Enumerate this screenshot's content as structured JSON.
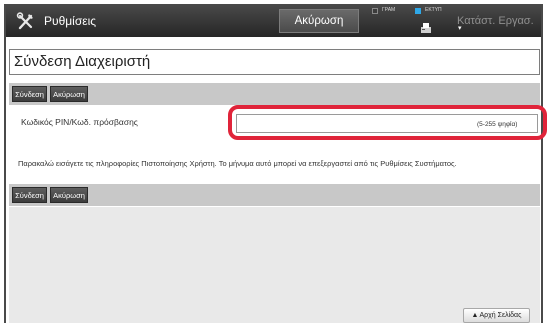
{
  "topbar": {
    "settings_label": "Ρυθμίσεις",
    "cancel_label": "Ακύρωση",
    "print_status": "ΓΡΑΜ",
    "fax_status": "ΕΚΤΥΠ",
    "job_status_label": "Κατάστ. Εργασ."
  },
  "page": {
    "title": "Σύνδεση Διαχειριστή"
  },
  "buttons": {
    "login": "Σύνδεση",
    "cancel": "Ακύρωση"
  },
  "pin": {
    "label": "Κωδικός PIN/Κωδ. πρόσβασης",
    "value": "",
    "hint": "(5-255 ψηφία)"
  },
  "info_text": "Παρακαλώ εισάγετε τις πληροφορίες Πιστοποίησης Χρήστη. Το μήνυμα αυτό μπορεί να επεξεργαστεί από τις Ρυθμίσεις Συστήματος.",
  "footer": {
    "top_label": "Αρχή Σελίδας"
  },
  "colors": {
    "highlight": "#e0243a",
    "fax_indicator": "#2fa8e8",
    "topbar": "#262626"
  }
}
